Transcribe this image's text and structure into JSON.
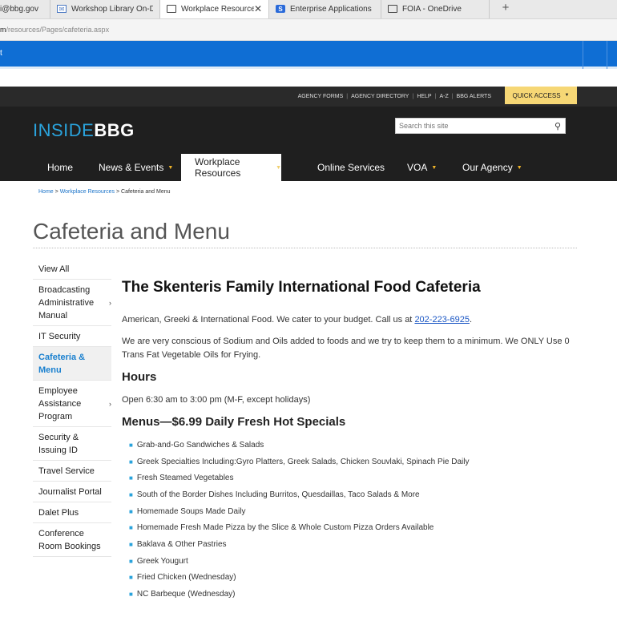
{
  "browser": {
    "tabs": [
      {
        "label": "i@bbg.gov",
        "icon": "none",
        "active": false
      },
      {
        "label": "Workshop Library On-Dema",
        "icon": "envelope-icon",
        "active": false
      },
      {
        "label": "Workplace Resources C",
        "icon": "window-icon",
        "active": true,
        "close": "✕"
      },
      {
        "label": "Enterprise Applications Limi",
        "icon": "sharepoint-icon",
        "active": false
      },
      {
        "label": "FOIA - OneDrive",
        "icon": "window-icon",
        "active": false
      }
    ],
    "new_tab": "+",
    "address": {
      "domain": "m",
      "path": "/resources/Pages/cafeteria.aspx"
    },
    "blue_bar_char": "t"
  },
  "site": {
    "utility_links": [
      "AGENCY FORMS",
      "AGENCY DIRECTORY",
      "HELP",
      "A-Z",
      "BBG ALERTS"
    ],
    "quick_access": "QUICK ACCESS",
    "logo": {
      "part1": "INSIDE",
      "part2": "BBG"
    },
    "search_placeholder": "Search this site",
    "nav": [
      {
        "label": "Home",
        "caret": false
      },
      {
        "label": "News & Events",
        "caret": true
      },
      {
        "label": "Workplace Resources",
        "caret": true,
        "active": true
      },
      {
        "label": "Online Services",
        "caret": false
      },
      {
        "label": "VOA",
        "caret": true
      },
      {
        "label": "Our Agency",
        "caret": true
      }
    ]
  },
  "breadcrumb": {
    "home": "Home",
    "sep": ">",
    "parent": "Workplace Resources",
    "current": "Cafeteria and Menu"
  },
  "page_title": "Cafeteria and Menu",
  "sidebar": [
    {
      "label": "View All",
      "chevron": false,
      "active": false
    },
    {
      "label": "Broadcasting Administrative Manual",
      "chevron": true,
      "active": false
    },
    {
      "label": "IT Security",
      "chevron": false,
      "active": false
    },
    {
      "label": "Cafeteria & Menu",
      "chevron": false,
      "active": true
    },
    {
      "label": "Employee Assistance Program",
      "chevron": true,
      "active": false
    },
    {
      "label": "Security & Issuing ID",
      "chevron": false,
      "active": false
    },
    {
      "label": "Travel Service",
      "chevron": false,
      "active": false
    },
    {
      "label": "Journalist Portal",
      "chevron": false,
      "active": false
    },
    {
      "label": "Dalet Plus",
      "chevron": false,
      "active": false
    },
    {
      "label": "Conference Room Bookings",
      "chevron": false,
      "active": false
    }
  ],
  "content": {
    "title": "The Skenteris Family International Food Cafeteria",
    "intro_text": "American, Greeki & International Food. We cater to your budget. Call us at ",
    "phone": "202-223-6925",
    "intro_end": ".",
    "sodium_text": "We are very conscious of Sodium and Oils added to foods and we try to keep them to a minimum. We ONLY Use 0 Trans Fat Vegetable Oils for Frying.",
    "hours_heading": "Hours",
    "hours_text": "Open 6:30 am to 3:00 pm (M-F, except holidays)",
    "menus_heading": "Menus—$6.99 Daily Fresh Hot Specials",
    "menu_items": [
      "Grab-and-Go Sandwiches & Salads",
      "Greek Specialties Including:Gyro Platters, Greek Salads, Chicken Souvlaki, Spinach Pie Daily",
      "Fresh Steamed Vegetables",
      "South of the Border Dishes Including Burritos, Quesdaillas, Taco Salads & More",
      "Homemade Soups Made Daily",
      "Homemade Fresh Made Pizza by the Slice & Whole Custom Pizza Orders Available",
      "Baklava & Other Pastries",
      "Greek Yougurt",
      "Fried Chicken (Wednesday)",
      "NC Barbeque (Wednesday)"
    ]
  },
  "colors": {
    "accent_blue": "#2aa3dc",
    "browser_blue": "#0f6ed4",
    "header_dark": "#1f1f1f",
    "quick_access_yellow": "#f6d775",
    "nav_caret": "#f0b429"
  }
}
